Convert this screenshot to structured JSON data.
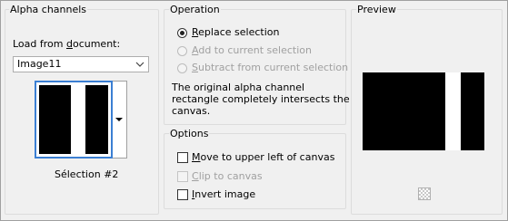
{
  "alpha_channels": {
    "title": "Alpha channels",
    "load_from_label": "Load from ",
    "load_from_underline": "d",
    "load_from_rest": "ocument:",
    "document_value": "Image11",
    "channel_name": "Sélection #2"
  },
  "operation": {
    "title": "Operation",
    "replace": {
      "u": "R",
      "rest": "eplace selection",
      "selected": true,
      "enabled": true
    },
    "add": {
      "u": "A",
      "rest": "dd to current selection",
      "selected": false,
      "enabled": false
    },
    "subtract": {
      "u": "S",
      "rest": "ubtract from current selection",
      "selected": false,
      "enabled": false
    },
    "message_line1": "The original alpha channel",
    "message_line2": "rectangle completely intersects the",
    "message_line3": "canvas."
  },
  "options": {
    "title": "Options",
    "move": {
      "u": "M",
      "rest": "ove to upper left of canvas",
      "checked": false,
      "enabled": true
    },
    "clip": {
      "u": "C",
      "rest": "lip to canvas",
      "checked": false,
      "enabled": false
    },
    "invert": {
      "u": "I",
      "rest": "nvert image",
      "checked": false,
      "enabled": true
    }
  },
  "preview": {
    "title": "Preview",
    "background_toggle_icon": "checkerboard-icon"
  },
  "colors": {
    "window_bg": "#f0f0f0",
    "selection_border": "#3b7fd3",
    "disabled_text": "#a0a0a0"
  }
}
